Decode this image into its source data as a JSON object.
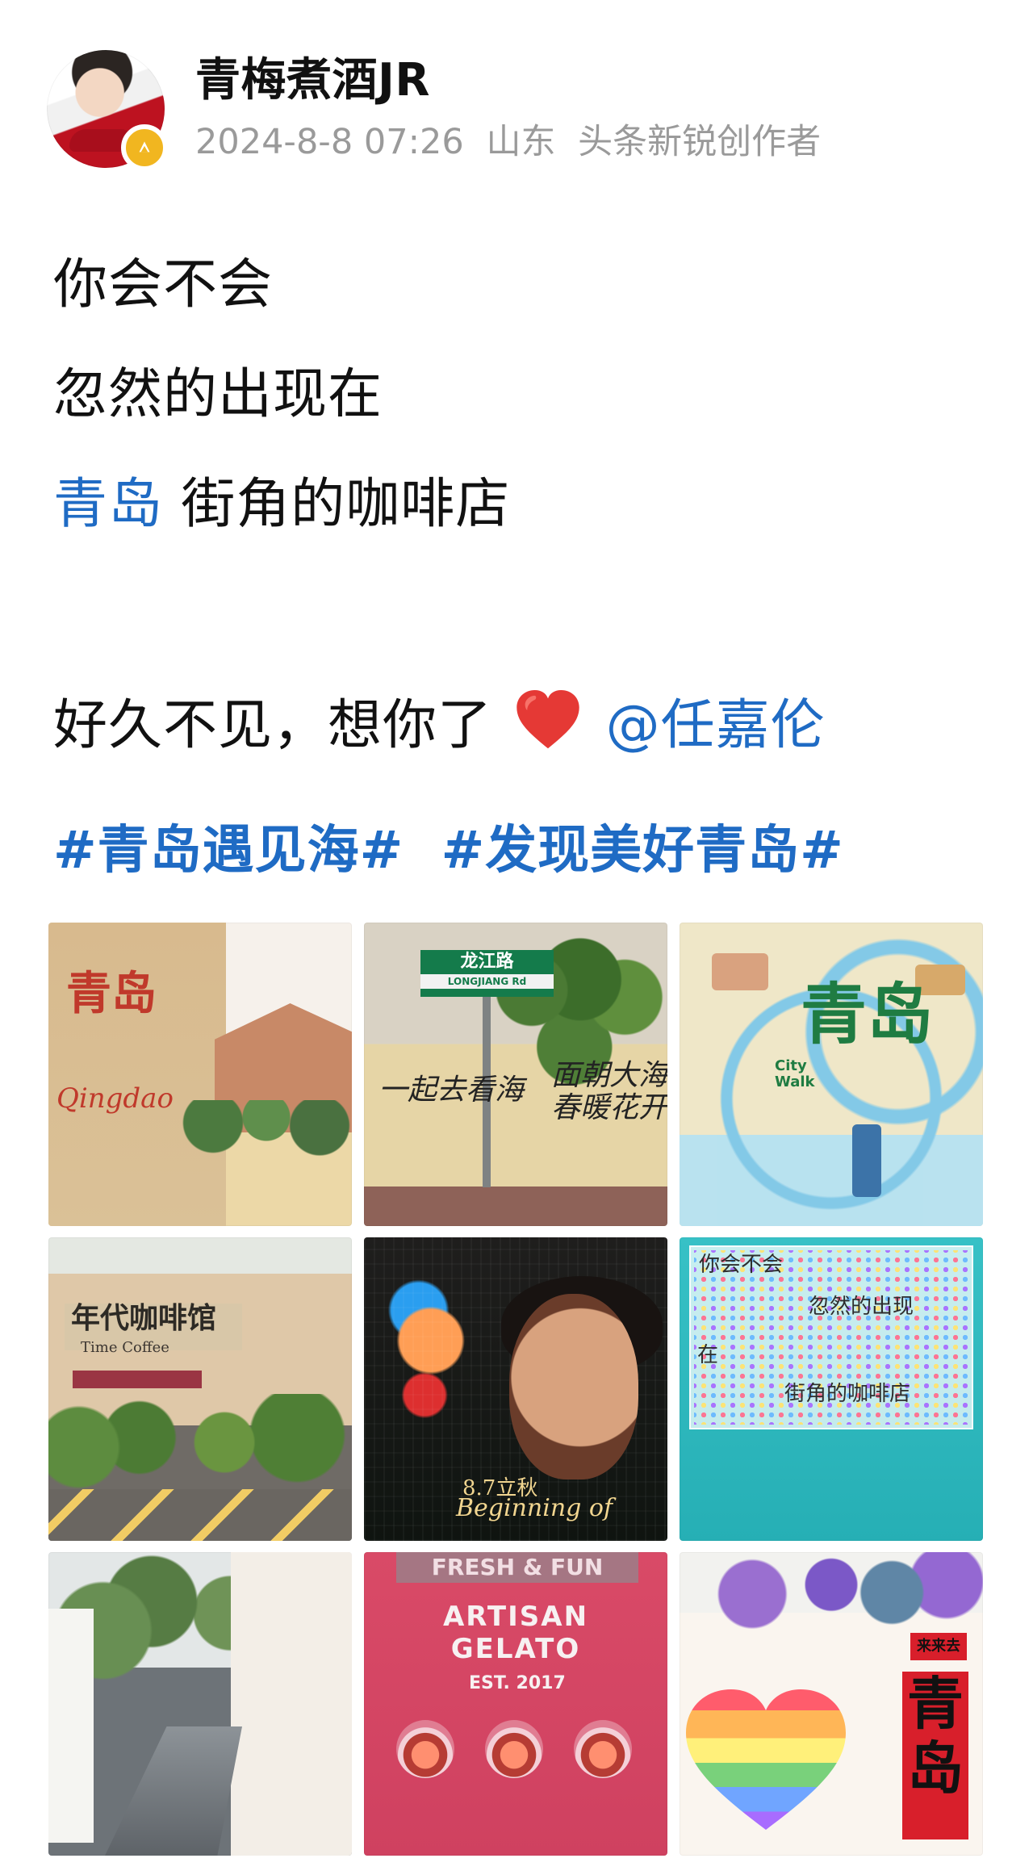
{
  "header": {
    "username": "青梅煮酒JR",
    "meta": {
      "datetime": "2024-8-8 07:26",
      "location": "山东",
      "creator_tag": "头条新锐创作者"
    },
    "avatar_icon": "avatar-photo",
    "badge_icon": "verified-badge-icon",
    "badge_color": "#f1b620"
  },
  "post": {
    "lines": [
      "你会不会",
      "忽然的出现在"
    ],
    "line3": {
      "link": "青岛",
      "rest": "街角的咖啡店"
    },
    "line4": {
      "text": "好久不见，想你了",
      "heart_icon": "red-heart-icon",
      "mention": "@任嘉伦"
    },
    "hashtags": [
      "#青岛遇见海#",
      "#发现美好青岛#"
    ],
    "link_color": "#1f6bc4"
  },
  "gallery": {
    "tiles": [
      {
        "name": "photo-qingdao-sign",
        "texts": {
          "cn": "青岛",
          "en": "Qingdao"
        }
      },
      {
        "name": "photo-longjiang-road",
        "texts": {
          "street_cn": "龙江路",
          "street_en": "LONGJIANG Rd",
          "left_wall": "一起去看海",
          "right_wall": "面朝大海\n春暖花开"
        }
      },
      {
        "name": "photo-qingdao-map",
        "texts": {
          "title": "青岛",
          "subtitle": "City\nWalk"
        }
      },
      {
        "name": "photo-time-coffee",
        "texts": {
          "cn": "年代咖啡馆",
          "en": "Time Coffee"
        }
      },
      {
        "name": "photo-poster-portrait",
        "texts": {
          "line1": "8.7立秋",
          "line2": "Beginning of"
        }
      },
      {
        "name": "photo-ball-wall",
        "texts": {
          "t1": "你会不会",
          "t2": "忽然的出现",
          "t3": "在",
          "t4": "街角的咖啡店"
        }
      },
      {
        "name": "photo-alley-street",
        "texts": {}
      },
      {
        "name": "photo-artisan-gelato",
        "texts": {
          "top": "FRESH & FUN",
          "title": "ARTISAN GELATO",
          "est": "EST. 2017"
        }
      },
      {
        "name": "photo-rainbow-heart",
        "texts": {
          "small_sign": "来来去",
          "big_sign": "青岛"
        }
      }
    ]
  }
}
